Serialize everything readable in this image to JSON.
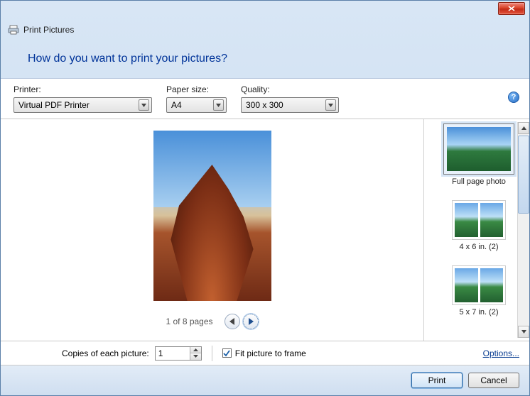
{
  "title": "Print Pictures",
  "question": "How do you want to print your pictures?",
  "labels": {
    "printer": "Printer:",
    "paperSize": "Paper size:",
    "quality": "Quality:"
  },
  "printer": {
    "selected": "Virtual PDF Printer"
  },
  "paperSize": {
    "selected": "A4"
  },
  "quality": {
    "selected": "300 x 300"
  },
  "pager": {
    "text": "1 of 8 pages"
  },
  "layouts": [
    {
      "label": "Full page photo"
    },
    {
      "label": "4 x 6 in. (2)"
    },
    {
      "label": "5 x 7 in. (2)"
    }
  ],
  "copies": {
    "label": "Copies of each picture:",
    "value": "1"
  },
  "fitToFrame": {
    "label": "Fit picture to frame",
    "checked": true
  },
  "optionsLink": "Options...",
  "buttons": {
    "print": "Print",
    "cancel": "Cancel"
  },
  "help": "?"
}
